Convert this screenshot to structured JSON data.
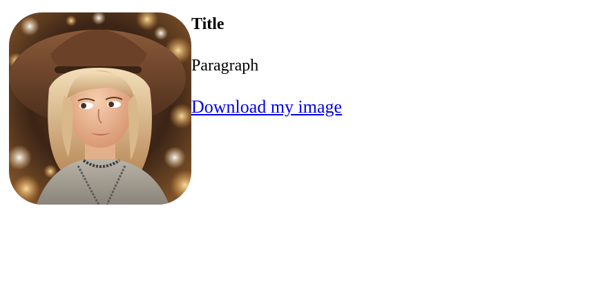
{
  "card": {
    "image_description": "illustrated portrait",
    "title": "Title",
    "paragraph": "Paragraph",
    "link_label": "Download my image"
  },
  "colors": {
    "link": "#0000ee",
    "text": "#000000",
    "background": "#ffffff"
  }
}
